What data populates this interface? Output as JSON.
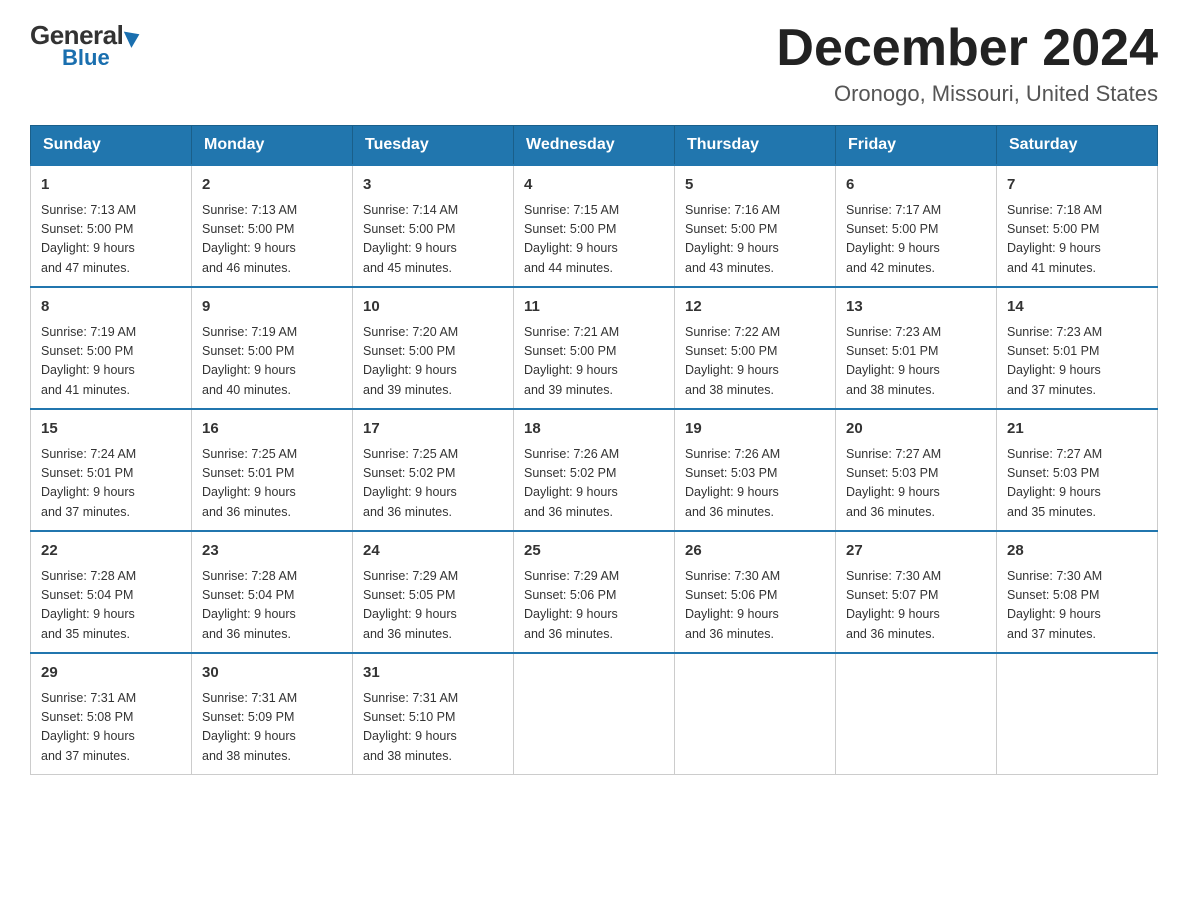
{
  "logo": {
    "general": "General",
    "arrow": "▶",
    "blue": "Blue"
  },
  "header": {
    "month_title": "December 2024",
    "location": "Oronogo, Missouri, United States"
  },
  "days_of_week": [
    "Sunday",
    "Monday",
    "Tuesday",
    "Wednesday",
    "Thursday",
    "Friday",
    "Saturday"
  ],
  "weeks": [
    [
      {
        "day": "1",
        "sunrise": "7:13 AM",
        "sunset": "5:00 PM",
        "daylight": "9 hours and 47 minutes."
      },
      {
        "day": "2",
        "sunrise": "7:13 AM",
        "sunset": "5:00 PM",
        "daylight": "9 hours and 46 minutes."
      },
      {
        "day": "3",
        "sunrise": "7:14 AM",
        "sunset": "5:00 PM",
        "daylight": "9 hours and 45 minutes."
      },
      {
        "day": "4",
        "sunrise": "7:15 AM",
        "sunset": "5:00 PM",
        "daylight": "9 hours and 44 minutes."
      },
      {
        "day": "5",
        "sunrise": "7:16 AM",
        "sunset": "5:00 PM",
        "daylight": "9 hours and 43 minutes."
      },
      {
        "day": "6",
        "sunrise": "7:17 AM",
        "sunset": "5:00 PM",
        "daylight": "9 hours and 42 minutes."
      },
      {
        "day": "7",
        "sunrise": "7:18 AM",
        "sunset": "5:00 PM",
        "daylight": "9 hours and 41 minutes."
      }
    ],
    [
      {
        "day": "8",
        "sunrise": "7:19 AM",
        "sunset": "5:00 PM",
        "daylight": "9 hours and 41 minutes."
      },
      {
        "day": "9",
        "sunrise": "7:19 AM",
        "sunset": "5:00 PM",
        "daylight": "9 hours and 40 minutes."
      },
      {
        "day": "10",
        "sunrise": "7:20 AM",
        "sunset": "5:00 PM",
        "daylight": "9 hours and 39 minutes."
      },
      {
        "day": "11",
        "sunrise": "7:21 AM",
        "sunset": "5:00 PM",
        "daylight": "9 hours and 39 minutes."
      },
      {
        "day": "12",
        "sunrise": "7:22 AM",
        "sunset": "5:00 PM",
        "daylight": "9 hours and 38 minutes."
      },
      {
        "day": "13",
        "sunrise": "7:23 AM",
        "sunset": "5:01 PM",
        "daylight": "9 hours and 38 minutes."
      },
      {
        "day": "14",
        "sunrise": "7:23 AM",
        "sunset": "5:01 PM",
        "daylight": "9 hours and 37 minutes."
      }
    ],
    [
      {
        "day": "15",
        "sunrise": "7:24 AM",
        "sunset": "5:01 PM",
        "daylight": "9 hours and 37 minutes."
      },
      {
        "day": "16",
        "sunrise": "7:25 AM",
        "sunset": "5:01 PM",
        "daylight": "9 hours and 36 minutes."
      },
      {
        "day": "17",
        "sunrise": "7:25 AM",
        "sunset": "5:02 PM",
        "daylight": "9 hours and 36 minutes."
      },
      {
        "day": "18",
        "sunrise": "7:26 AM",
        "sunset": "5:02 PM",
        "daylight": "9 hours and 36 minutes."
      },
      {
        "day": "19",
        "sunrise": "7:26 AM",
        "sunset": "5:03 PM",
        "daylight": "9 hours and 36 minutes."
      },
      {
        "day": "20",
        "sunrise": "7:27 AM",
        "sunset": "5:03 PM",
        "daylight": "9 hours and 36 minutes."
      },
      {
        "day": "21",
        "sunrise": "7:27 AM",
        "sunset": "5:03 PM",
        "daylight": "9 hours and 35 minutes."
      }
    ],
    [
      {
        "day": "22",
        "sunrise": "7:28 AM",
        "sunset": "5:04 PM",
        "daylight": "9 hours and 35 minutes."
      },
      {
        "day": "23",
        "sunrise": "7:28 AM",
        "sunset": "5:04 PM",
        "daylight": "9 hours and 36 minutes."
      },
      {
        "day": "24",
        "sunrise": "7:29 AM",
        "sunset": "5:05 PM",
        "daylight": "9 hours and 36 minutes."
      },
      {
        "day": "25",
        "sunrise": "7:29 AM",
        "sunset": "5:06 PM",
        "daylight": "9 hours and 36 minutes."
      },
      {
        "day": "26",
        "sunrise": "7:30 AM",
        "sunset": "5:06 PM",
        "daylight": "9 hours and 36 minutes."
      },
      {
        "day": "27",
        "sunrise": "7:30 AM",
        "sunset": "5:07 PM",
        "daylight": "9 hours and 36 minutes."
      },
      {
        "day": "28",
        "sunrise": "7:30 AM",
        "sunset": "5:08 PM",
        "daylight": "9 hours and 37 minutes."
      }
    ],
    [
      {
        "day": "29",
        "sunrise": "7:31 AM",
        "sunset": "5:08 PM",
        "daylight": "9 hours and 37 minutes."
      },
      {
        "day": "30",
        "sunrise": "7:31 AM",
        "sunset": "5:09 PM",
        "daylight": "9 hours and 38 minutes."
      },
      {
        "day": "31",
        "sunrise": "7:31 AM",
        "sunset": "5:10 PM",
        "daylight": "9 hours and 38 minutes."
      },
      null,
      null,
      null,
      null
    ]
  ],
  "labels": {
    "sunrise": "Sunrise:",
    "sunset": "Sunset:",
    "daylight": "Daylight:"
  }
}
